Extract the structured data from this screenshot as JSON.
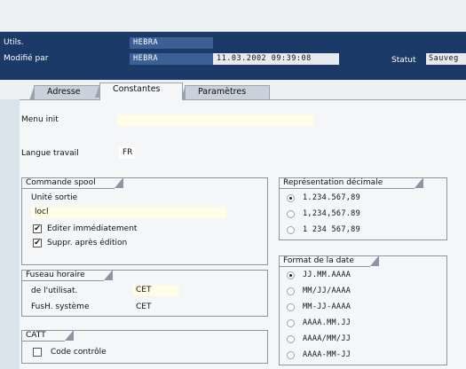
{
  "window": {
    "title_partial": "' ' ' ' ' ' "
  },
  "header": {
    "utils_label": "Utils.",
    "utils_value": "HEBRA",
    "modifie_label": "Modifié par",
    "modifie_value": "HEBRA",
    "modifie_datetime": "11.03.2002 09:39:08",
    "statut_label": "Statut",
    "statut_value": "Sauveg"
  },
  "tabs": [
    {
      "label": "Adresse"
    },
    {
      "label": "Constantes",
      "active": true
    },
    {
      "label": "Paramètres"
    }
  ],
  "main": {
    "menu_init_label": "Menu init",
    "menu_init_value": "",
    "langue_label": "Langue travail",
    "langue_value": "FR"
  },
  "spool": {
    "title": "Commande spool",
    "unite_label": "Unité sortie",
    "unite_value": "locl",
    "editer_label": "Editer immédiatement",
    "editer_checked": true,
    "suppr_label": "Suppr. après édition",
    "suppr_checked": true
  },
  "fuseau": {
    "title": "Fuseau horaire",
    "user_label": "de l'utilisat.",
    "user_value": "CET",
    "sys_label": "FusH. système",
    "sys_value": "CET"
  },
  "catt": {
    "title": "CATT",
    "code_label": "Code contrôle",
    "code_checked": false
  },
  "decimal": {
    "title": "Représentation décimale",
    "options": [
      {
        "label": "1.234.567,89",
        "selected": true
      },
      {
        "label": "1,234,567.89",
        "selected": false
      },
      {
        "label": "1 234 567,89",
        "selected": false
      }
    ]
  },
  "date_format": {
    "title": "Format de la date",
    "options": [
      {
        "label": "JJ.MM.AAAA",
        "selected": true
      },
      {
        "label": "MM/JJ/AAAA",
        "selected": false
      },
      {
        "label": "MM-JJ-AAAA",
        "selected": false
      },
      {
        "label": "AAAA.MM.JJ",
        "selected": false
      },
      {
        "label": "AAAA/MM/JJ",
        "selected": false
      },
      {
        "label": "AAAA-MM-JJ",
        "selected": false
      }
    ]
  },
  "colors": {
    "header_bg": "#1c3a68",
    "header_field": "#3c5f96",
    "panel_bg": "#f4f6f8",
    "input_yellow": "#fffde6"
  },
  "icons": {
    "check": "check-icon"
  }
}
